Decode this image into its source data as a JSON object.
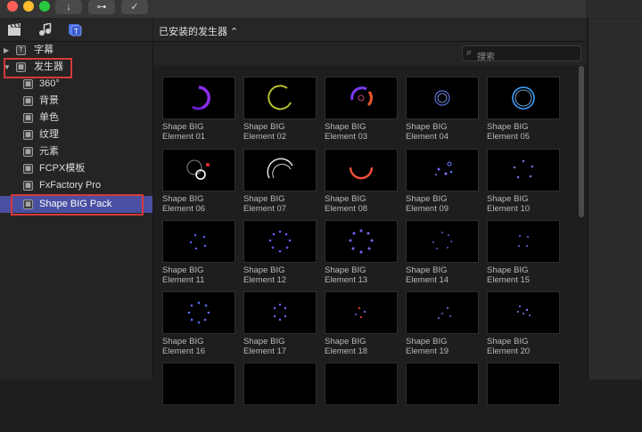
{
  "toolbar": {
    "import_glyph": "↓",
    "key_glyph": "⊶",
    "check_glyph": "✓"
  },
  "library_icons": [
    "clapper-icon",
    "music-icon",
    "titles-generators-icon"
  ],
  "sidebar": {
    "items": [
      {
        "label": "字幕",
        "expanded": false
      },
      {
        "label": "发生器",
        "expanded": true
      },
      {
        "label": "360°"
      },
      {
        "label": "背景"
      },
      {
        "label": "单色"
      },
      {
        "label": "纹理"
      },
      {
        "label": "元素"
      },
      {
        "label": "FCPX模板"
      },
      {
        "label": "FxFactory Pro"
      },
      {
        "label": "Shape BIG Pack",
        "selected": true
      }
    ]
  },
  "browser": {
    "title": "已安装的发生器 ⌃",
    "search_placeholder": "搜索"
  },
  "tiles": [
    {
      "line1": "Shape BIG",
      "line2": "Element 01"
    },
    {
      "line1": "Shape BIG",
      "line2": "Element 02"
    },
    {
      "line1": "Shape BIG",
      "line2": "Element 03"
    },
    {
      "line1": "Shape BIG",
      "line2": "Element 04"
    },
    {
      "line1": "Shape BIG",
      "line2": "Element 05"
    },
    {
      "line1": "Shape BIG",
      "line2": "Element 06"
    },
    {
      "line1": "Shape BIG",
      "line2": "Element 07"
    },
    {
      "line1": "Shape BIG",
      "line2": "Element 08"
    },
    {
      "line1": "Shape BIG",
      "line2": "Element 09"
    },
    {
      "line1": "Shape BIG",
      "line2": "Element 10"
    },
    {
      "line1": "Shape BIG",
      "line2": "Element 11"
    },
    {
      "line1": "Shape BIG",
      "line2": "Element 12"
    },
    {
      "line1": "Shape BIG",
      "line2": "Element 13"
    },
    {
      "line1": "Shape BIG",
      "line2": "Element 14"
    },
    {
      "line1": "Shape BIG",
      "line2": "Element 15"
    },
    {
      "line1": "Shape BIG",
      "line2": "Element 16"
    },
    {
      "line1": "Shape BIG",
      "line2": "Element 17"
    },
    {
      "line1": "Shape BIG",
      "line2": "Element 18"
    },
    {
      "line1": "Shape BIG",
      "line2": "Element 19"
    },
    {
      "line1": "Shape BIG",
      "line2": "Element 20"
    }
  ],
  "colors": {
    "selection": "#4b4fa1",
    "highlight_box": "#d43a3a",
    "close": "#ff5f57",
    "minimize": "#febc2e",
    "zoom": "#28c840"
  }
}
